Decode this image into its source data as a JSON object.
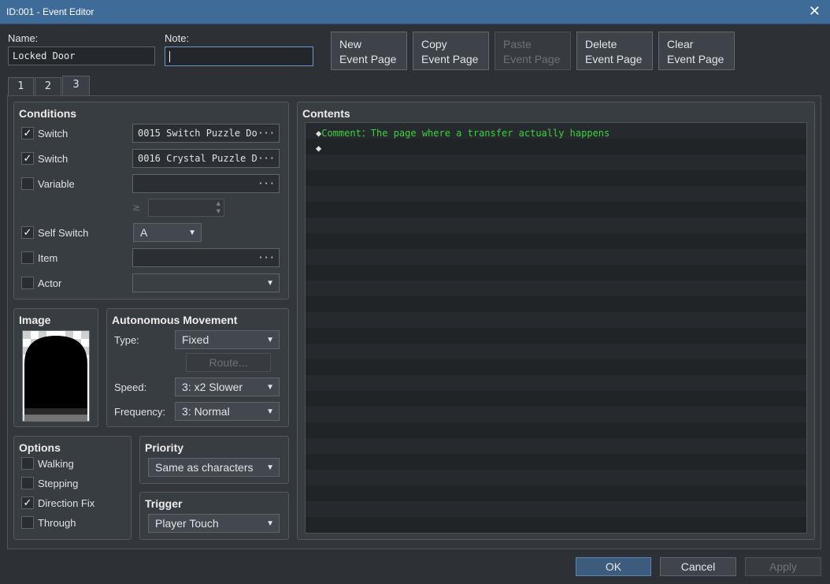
{
  "window": {
    "title": "ID:001 - Event Editor",
    "close_glyph": "✕"
  },
  "header": {
    "name_label": "Name:",
    "name_value": "Locked Door",
    "note_label": "Note:",
    "note_value": "",
    "buttons": [
      {
        "line1": "New",
        "line2": "Event Page",
        "enabled": true
      },
      {
        "line1": "Copy",
        "line2": "Event Page",
        "enabled": true
      },
      {
        "line1": "Paste",
        "line2": "Event Page",
        "enabled": false
      },
      {
        "line1": "Delete",
        "line2": "Event Page",
        "enabled": true
      },
      {
        "line1": "Clear",
        "line2": "Event Page",
        "enabled": true
      }
    ]
  },
  "tabs": [
    {
      "label": "1"
    },
    {
      "label": "2"
    },
    {
      "label": "3",
      "active": true
    }
  ],
  "conditions": {
    "title": "Conditions",
    "switch1": {
      "label": "Switch",
      "checked": true,
      "value": "0015 Switch Puzzle Do",
      "dots": "···"
    },
    "switch2": {
      "label": "Switch",
      "checked": true,
      "value": "0016 Crystal Puzzle D",
      "dots": "···"
    },
    "variable": {
      "label": "Variable",
      "checked": false,
      "value": "",
      "dots": "···",
      "op": "≥"
    },
    "self_switch": {
      "label": "Self Switch",
      "checked": true,
      "value": "A"
    },
    "item": {
      "label": "Item",
      "checked": false,
      "value": "",
      "dots": "···"
    },
    "actor": {
      "label": "Actor",
      "checked": false,
      "value": ""
    },
    "check_glyph": "✓"
  },
  "image": {
    "title": "Image"
  },
  "movement": {
    "title": "Autonomous Movement",
    "type_label": "Type:",
    "type_value": "Fixed",
    "route_label": "Route...",
    "speed_label": "Speed:",
    "speed_value": "3: x2 Slower",
    "freq_label": "Frequency:",
    "freq_value": "3: Normal"
  },
  "options": {
    "title": "Options",
    "items": [
      {
        "label": "Walking",
        "checked": false
      },
      {
        "label": "Stepping",
        "checked": false
      },
      {
        "label": "Direction Fix",
        "checked": true
      },
      {
        "label": "Through",
        "checked": false
      }
    ]
  },
  "priority": {
    "title": "Priority",
    "value": "Same as characters"
  },
  "trigger": {
    "title": "Trigger",
    "value": "Player Touch"
  },
  "contents": {
    "title": "Contents",
    "lines": [
      {
        "prefix": "◆",
        "text": "Comment：The page where a transfer actually happens",
        "color": "#39d43a"
      },
      {
        "prefix": "◆",
        "text": "",
        "color": "#e0e0e0"
      }
    ]
  },
  "footer": {
    "ok": "OK",
    "cancel": "Cancel",
    "apply": "Apply"
  },
  "colors": {
    "accent": "#3f6b98",
    "comment_green": "#39d43a"
  }
}
